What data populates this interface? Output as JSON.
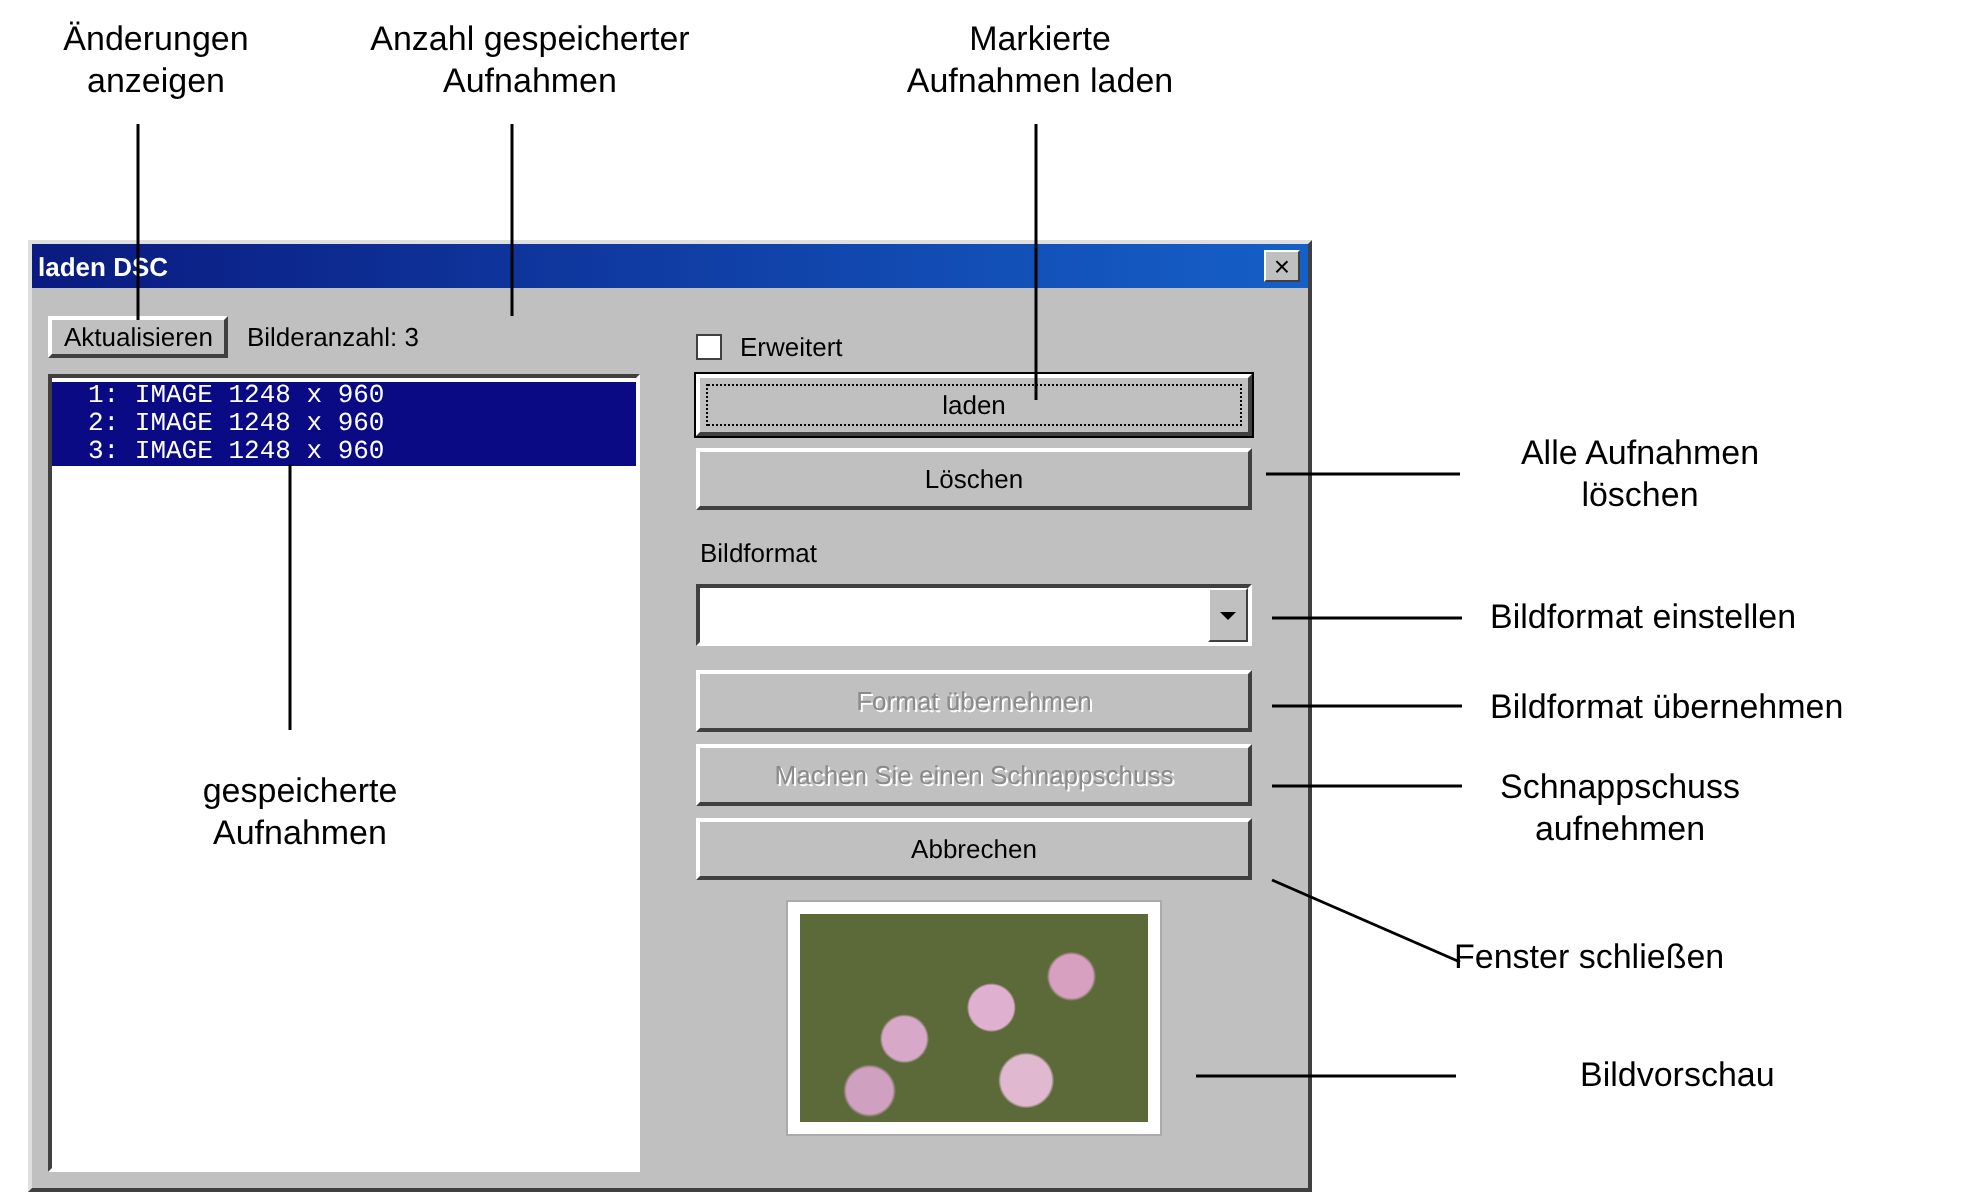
{
  "window": {
    "title": "laden DSC",
    "close": "×"
  },
  "refresh_button": {
    "label": "Aktualisieren"
  },
  "image_count": "Bilderanzahl: 3",
  "image_list": [
    {
      "label": "1: IMAGE 1248 x 960",
      "selected": true
    },
    {
      "label": "2: IMAGE 1248 x 960",
      "selected": true
    },
    {
      "label": "3: IMAGE 1248 x 960",
      "selected": true
    }
  ],
  "extended_checkbox": {
    "label": "Erweitert",
    "checked": false
  },
  "buttons_top": [
    {
      "label": "laden",
      "disabled": false,
      "focused": true
    },
    {
      "label": "Löschen",
      "disabled": false,
      "focused": false
    }
  ],
  "format_select": {
    "label": "Bildformat"
  },
  "buttons_bottom": [
    {
      "label": "Format übernehmen",
      "disabled": true,
      "focused": false
    },
    {
      "label": "Machen Sie einen Schnappschuss",
      "disabled": true,
      "focused": false
    },
    {
      "label": "Abbrechen",
      "disabled": false,
      "focused": false
    }
  ],
  "callouts": [
    {
      "text": "Änderungen\nanzeigen"
    },
    {
      "text": "Anzahl gespeicherter\nAufnahmen"
    },
    {
      "text": "Markierte\nAufnahmen laden"
    },
    {
      "text": "gespeicherte\nAufnahmen"
    },
    {
      "text": "Alle Aufnahmen\nlöschen"
    },
    {
      "text": "Bildformat einstellen"
    },
    {
      "text": "Bildformat übernehmen"
    },
    {
      "text": "Schnappschuss\naufnehmen"
    },
    {
      "text": "Fenster schließen"
    },
    {
      "text": "Bildvorschau"
    }
  ]
}
